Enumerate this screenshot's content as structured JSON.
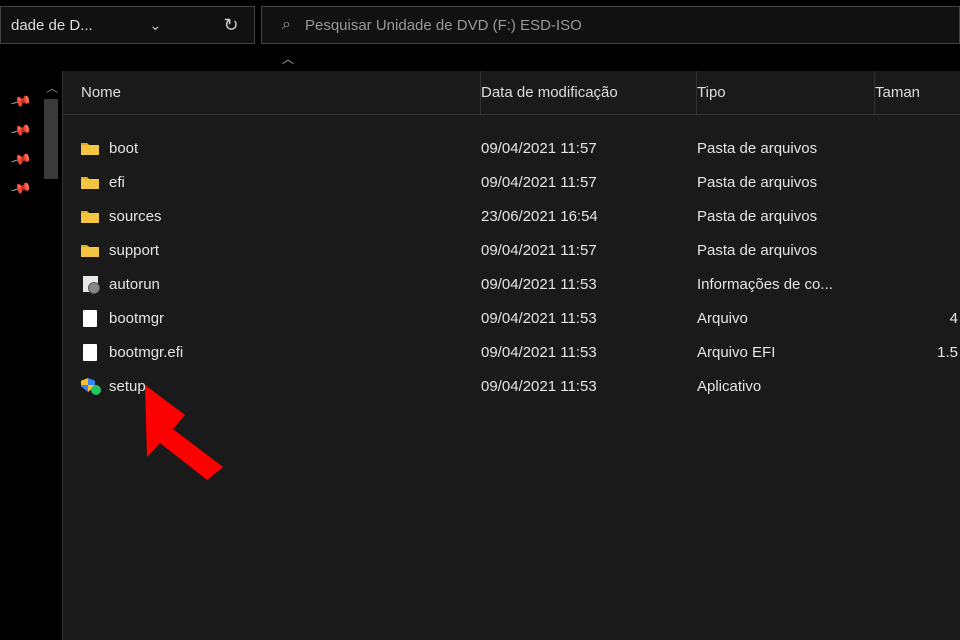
{
  "toolbar": {
    "breadcrumb_text": "dade de D...",
    "search_placeholder": "Pesquisar Unidade de DVD (F:) ESD-ISO"
  },
  "columns": {
    "name": "Nome",
    "date": "Data de modificação",
    "type": "Tipo",
    "size": "Taman"
  },
  "files": [
    {
      "icon": "folder",
      "name": "boot",
      "date": "09/04/2021 11:57",
      "type": "Pasta de arquivos",
      "size": ""
    },
    {
      "icon": "folder",
      "name": "efi",
      "date": "09/04/2021 11:57",
      "type": "Pasta de arquivos",
      "size": ""
    },
    {
      "icon": "folder",
      "name": "sources",
      "date": "23/06/2021 16:54",
      "type": "Pasta de arquivos",
      "size": ""
    },
    {
      "icon": "folder",
      "name": "support",
      "date": "09/04/2021 11:57",
      "type": "Pasta de arquivos",
      "size": ""
    },
    {
      "icon": "inf",
      "name": "autorun",
      "date": "09/04/2021 11:53",
      "type": "Informações de co...",
      "size": ""
    },
    {
      "icon": "file",
      "name": "bootmgr",
      "date": "09/04/2021 11:53",
      "type": "Arquivo",
      "size": "4"
    },
    {
      "icon": "file",
      "name": "bootmgr.efi",
      "date": "09/04/2021 11:53",
      "type": "Arquivo EFI",
      "size": "1.5"
    },
    {
      "icon": "exe",
      "name": "setup",
      "date": "09/04/2021 11:53",
      "type": "Aplicativo",
      "size": ""
    }
  ]
}
